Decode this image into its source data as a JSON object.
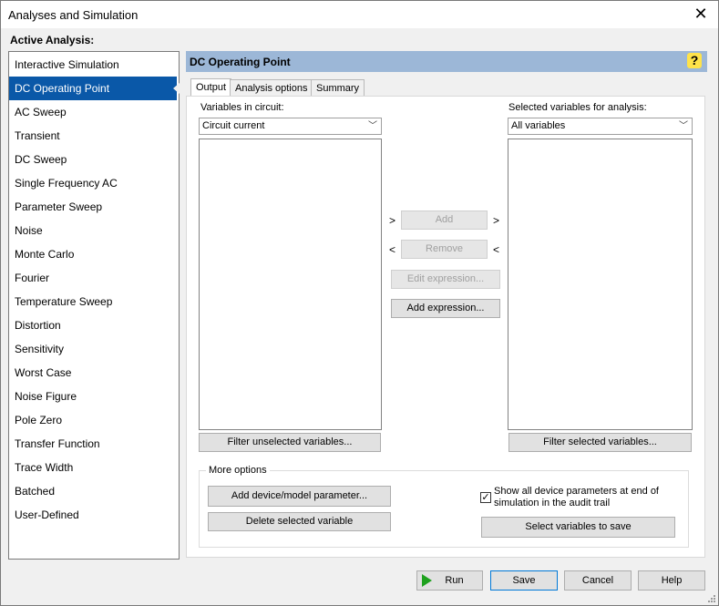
{
  "window": {
    "title": "Analyses and Simulation"
  },
  "sidebar": {
    "label": "Active Analysis:",
    "items": [
      "Interactive Simulation",
      "DC Operating Point",
      "AC Sweep",
      "Transient",
      "DC Sweep",
      "Single Frequency AC",
      "Parameter Sweep",
      "Noise",
      "Monte Carlo",
      "Fourier",
      "Temperature Sweep",
      "Distortion",
      "Sensitivity",
      "Worst Case",
      "Noise Figure",
      "Pole Zero",
      "Transfer Function",
      "Trace Width",
      "Batched",
      "User-Defined"
    ],
    "selected": "DC Operating Point"
  },
  "panel": {
    "title": "DC Operating Point",
    "help_icon": "question-mark-icon"
  },
  "tabs": [
    "Output",
    "Analysis options",
    "Summary"
  ],
  "output": {
    "vars_in_circuit_label": "Variables in circuit:",
    "vars_in_circuit_filter": "Circuit current",
    "selected_vars_label": "Selected variables for analysis:",
    "selected_vars_filter": "All variables",
    "add_left_arrow": ">",
    "add_label": "Add",
    "add_right_arrow": ">",
    "remove_left_arrow": "<",
    "remove_label": "Remove",
    "remove_right_arrow": "<",
    "edit_expression_label": "Edit expression...",
    "add_expression_label": "Add expression...",
    "filter_unselected_label": "Filter unselected variables...",
    "filter_selected_label": "Filter selected variables..."
  },
  "more_options": {
    "label": "More options",
    "add_param_label": "Add device/model parameter...",
    "delete_var_label": "Delete selected variable",
    "show_params_label": "Show all device parameters at end of simulation in the audit trail",
    "show_params_checked": true,
    "select_vars_save_label": "Select variables to save"
  },
  "footer": {
    "run": "Run",
    "save": "Save",
    "cancel": "Cancel",
    "help": "Help"
  },
  "colors": {
    "selection": "#0a58a8",
    "panel_header": "#9cb7d7",
    "run_icon": "#1ea11e"
  }
}
